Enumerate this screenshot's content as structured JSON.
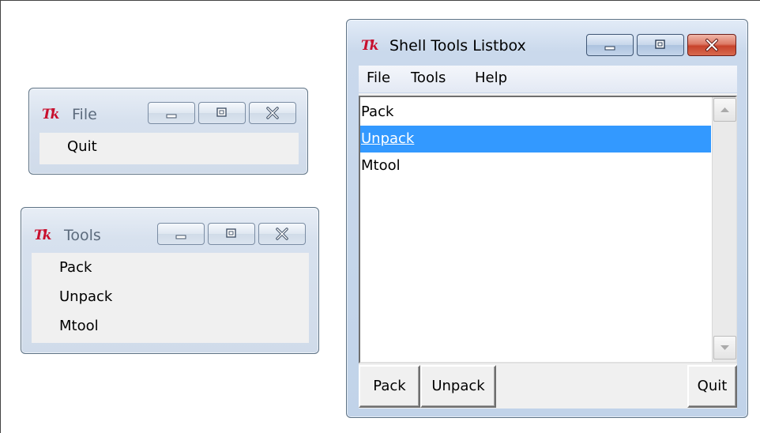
{
  "logo_text": "Tk",
  "windows": {
    "file": {
      "title": "File",
      "items": [
        "Quit"
      ]
    },
    "tools": {
      "title": "Tools",
      "items": [
        "Pack",
        "Unpack",
        "Mtool"
      ]
    },
    "shell": {
      "title": "Shell Tools Listbox",
      "menubar": [
        "File",
        "Tools",
        "Help"
      ],
      "listbox_items": [
        "Pack",
        "Unpack",
        "Mtool"
      ],
      "selected_item": "Unpack",
      "buttons": {
        "pack": "Pack",
        "unpack": "Unpack",
        "quit": "Quit"
      }
    }
  },
  "colors": {
    "selection": "#3399ff",
    "tk_logo": "#c8102e",
    "close_button": "#c7432b"
  },
  "icons": [
    "tk-logo-icon",
    "minimize-icon",
    "maximize-icon",
    "close-icon",
    "scroll-up-arrow-icon",
    "scroll-down-arrow-icon"
  ]
}
